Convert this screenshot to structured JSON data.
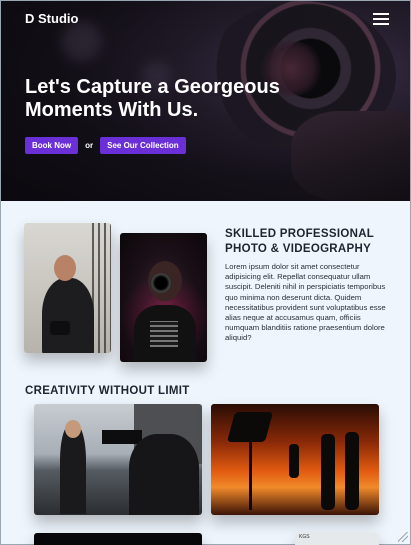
{
  "header": {
    "brand": "D Studio",
    "menu_icon": "hamburger-menu-icon"
  },
  "hero": {
    "title": "Let's Capture a Georgeous Moments With Us.",
    "primary_button": "Book Now",
    "separator": "or",
    "secondary_button": "See Our Collection",
    "accent_color": "#6a2fd6"
  },
  "about": {
    "title": "SKILLED PROFESSIONAL PHOTO & VIDEOGRAPHY",
    "text": "Lorem ipsum dolor sit amet consectetur adipisicing elit. Repellat consequatur ullam suscipit. Deleniti nihil in perspiciatis temporibus quo minima non deserunt dicta. Quidem necessitatibus provident sunt voluptatibus esse alias neque at accusamus quam, officiis numquam blanditiis ratione praesentium dolore aliquid?"
  },
  "gallery": {
    "title": "CREATIVITY WITHOUT LIMIT",
    "banner_text": "KGS"
  }
}
